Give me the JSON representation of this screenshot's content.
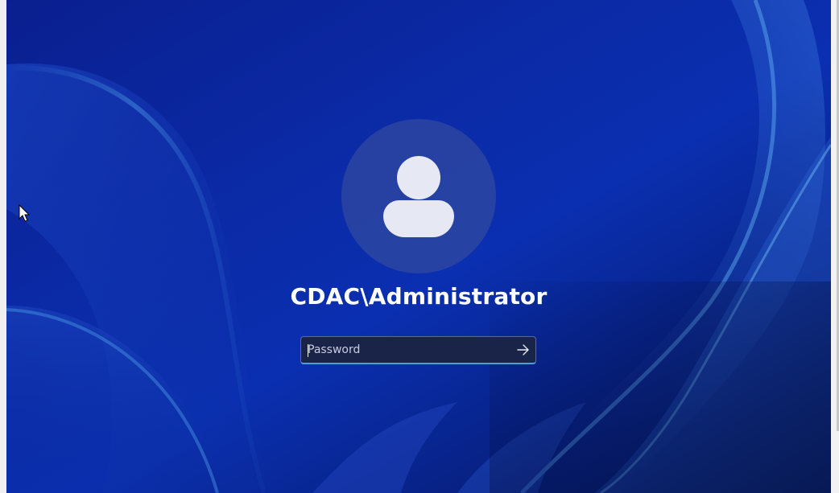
{
  "user": {
    "name": "CDAC\\Administrator"
  },
  "password": {
    "placeholder": "Password",
    "value": ""
  },
  "icons": {
    "avatar": "person-icon",
    "submit": "arrow-right-icon",
    "pointer": "mouse-pointer-icon"
  },
  "colors": {
    "background": "#0b2aa6",
    "field_focus": "#4a9de0",
    "text": "#ffffff"
  }
}
